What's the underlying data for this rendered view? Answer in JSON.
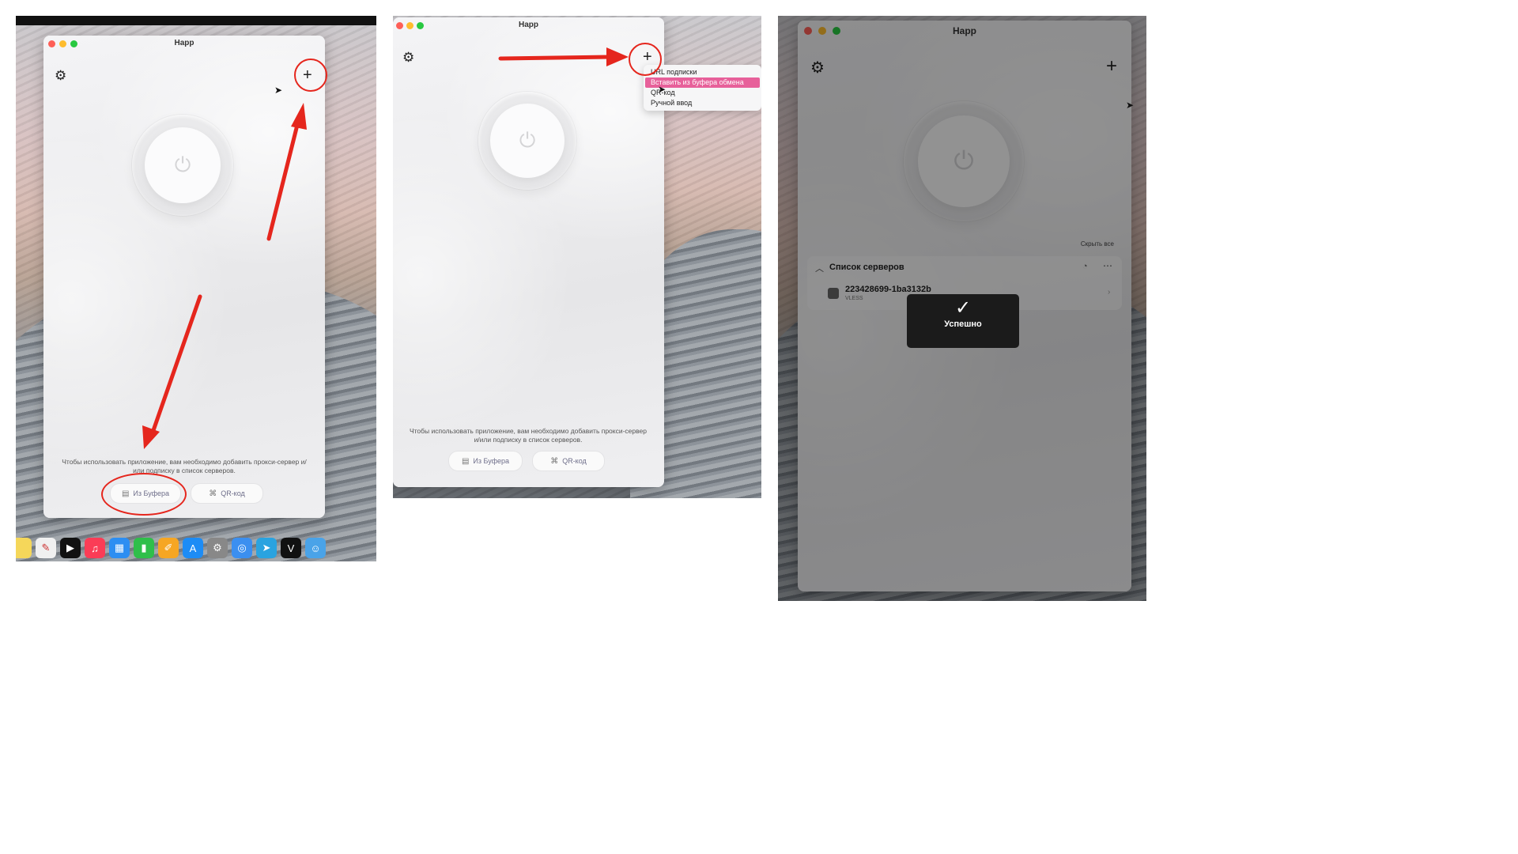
{
  "app": {
    "title": "Happ",
    "empty_hint": "Чтобы использовать приложение, вам необходимо добавить прокси-сервер и/или подписку в список серверов.",
    "btn_clipboard": "Из Буфера",
    "btn_qr": "QR-код",
    "icons": {
      "settings": "gear-icon",
      "add": "plus-icon",
      "power": "power-icon",
      "clipboard": "clipboard-icon",
      "qr": "qr-icon"
    }
  },
  "add_menu": {
    "items": [
      "URL подписки",
      "Вставить из буфера обмена",
      "QR-код",
      "Ручной ввод"
    ],
    "highlighted_index": 1,
    "highlight_color": "#e7609a"
  },
  "result": {
    "hide_all": "Скрыть все",
    "server_list_title": "Список серверов",
    "server_name": "223428699-1ba3132b",
    "server_protocol": "VLESS",
    "toast_text": "Успешно"
  },
  "accent": {
    "annotation_red": "#e5261d"
  }
}
